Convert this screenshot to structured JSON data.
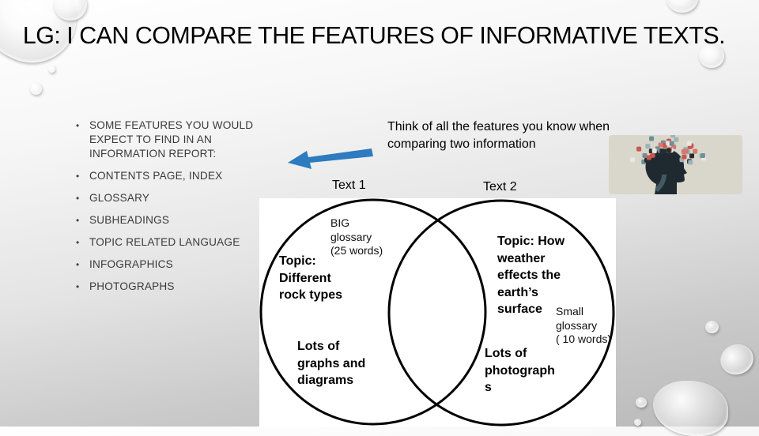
{
  "slide": {
    "title": "LG: I CAN COMPARE THE FEATURES OF INFORMATIVE TEXTS.",
    "bullets": [
      "SOME FEATURES YOU WOULD EXPECT TO FIND IN AN INFORMATION REPORT:",
      "CONTENTS PAGE, INDEX",
      "GLOSSARY",
      "SUBHEADINGS",
      "TOPIC RELATED LANGUAGE",
      "INFOGRAPHICS",
      "PHOTOGRAPHS"
    ],
    "prompt": "Think of all the features you know when comparing two information",
    "arrow_color": "#2e7bbf",
    "image_semantic": "head-with-puzzle-brain-image"
  },
  "venn": {
    "text1_label": "Text 1",
    "text2_label": "Text 2",
    "left": {
      "big_glossary": [
        "BIG",
        "glossary",
        "(25 words)"
      ],
      "topic": [
        "Topic:",
        "Different",
        "rock types"
      ],
      "graphs": [
        "Lots of",
        "graphs and",
        "diagrams"
      ]
    },
    "right": {
      "topic": [
        "Topic: How",
        "weather",
        "effects the",
        "earth’s",
        "surface"
      ],
      "small_glossary": [
        "Small",
        "glossary",
        "( 10 words)"
      ],
      "photos": [
        "Lots of",
        "photograph",
        "s"
      ]
    },
    "overlap": []
  }
}
